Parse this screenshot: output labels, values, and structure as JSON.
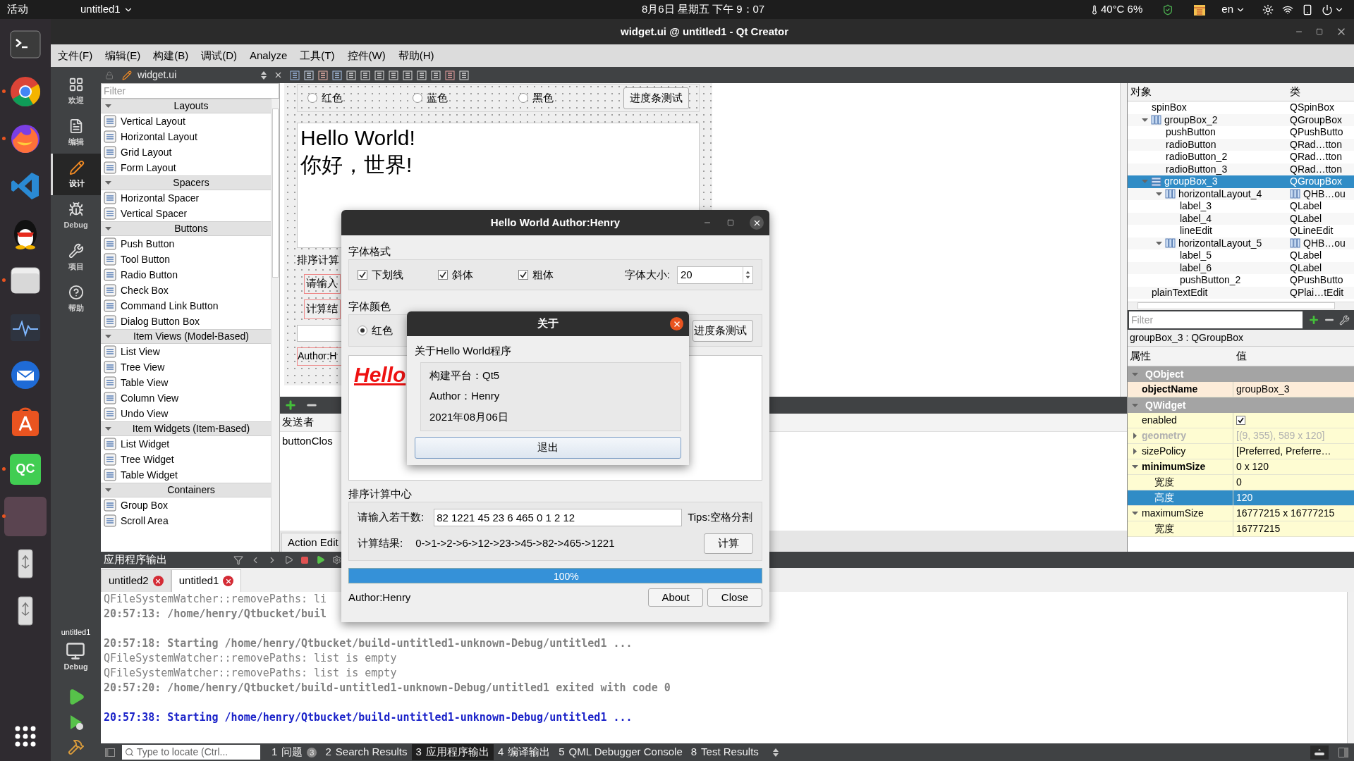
{
  "top_bar": {
    "activities": "活动",
    "app_menu": "untitled1",
    "clock": "8月6日 星期五 下午 9：07",
    "sensors": "40°C 6%",
    "input_method": "en"
  },
  "dock": [
    {
      "kind": "terminal",
      "running": false
    },
    {
      "kind": "chrome",
      "running": true
    },
    {
      "kind": "firefox",
      "running": true
    },
    {
      "kind": "code",
      "running": false
    },
    {
      "kind": "penguin",
      "running": false
    },
    {
      "kind": "files",
      "running": true
    },
    {
      "kind": "monitor",
      "running": false
    },
    {
      "kind": "mail",
      "running": false
    },
    {
      "kind": "store",
      "running": false
    },
    {
      "kind": "qc",
      "label": "QC",
      "running": true
    },
    {
      "kind": "window",
      "running": true
    },
    {
      "kind": "usb",
      "running": false
    },
    {
      "kind": "usb",
      "running": false
    },
    {
      "kind": "apps",
      "running": false
    }
  ],
  "window": {
    "title": "widget.ui @ untitled1 - Qt Creator"
  },
  "menu": [
    "文件(F)",
    "编辑(E)",
    "构建(B)",
    "调试(D)",
    "Analyze",
    "工具(T)",
    "控件(W)",
    "帮助(H)"
  ],
  "modes": [
    {
      "kind": "welcome",
      "label": "欢迎",
      "selected": false
    },
    {
      "kind": "edit",
      "label": "编辑",
      "selected": false
    },
    {
      "kind": "design",
      "label": "设计",
      "selected": true
    },
    {
      "kind": "debug",
      "label": "Debug",
      "selected": false
    },
    {
      "kind": "projects",
      "label": "项目",
      "selected": false
    },
    {
      "kind": "help",
      "label": "帮助",
      "selected": false
    }
  ],
  "run_target": {
    "project": "untitled1",
    "config": "Debug"
  },
  "editor_tab": {
    "file": "widget.ui"
  },
  "widget_box": {
    "filter_placeholder": "Filter",
    "sections": [
      {
        "title": "Layouts",
        "expanded": true,
        "items": [
          "Vertical Layout",
          "Horizontal Layout",
          "Grid Layout",
          "Form Layout"
        ]
      },
      {
        "title": "Spacers",
        "expanded": true,
        "items": [
          "Horizontal Spacer",
          "Vertical Spacer"
        ]
      },
      {
        "title": "Buttons",
        "expanded": true,
        "items": [
          "Push Button",
          "Tool Button",
          "Radio Button",
          "Check Box",
          "Command Link Button",
          "Dialog Button Box"
        ]
      },
      {
        "title": "Item Views (Model-Based)",
        "expanded": true,
        "items": [
          "List View",
          "Tree View",
          "Table View",
          "Column View",
          "Undo View"
        ]
      },
      {
        "title": "Item Widgets (Item-Based)",
        "expanded": true,
        "items": [
          "List Widget",
          "Tree Widget",
          "Table Widget"
        ]
      },
      {
        "title": "Containers",
        "expanded": true,
        "items": [
          "Group Box",
          "Scroll Area"
        ]
      }
    ]
  },
  "form_preview": {
    "radios": [
      {
        "label": "红色",
        "selected": false
      },
      {
        "label": "蓝色",
        "selected": false
      },
      {
        "label": "黑色",
        "selected": false
      }
    ],
    "button": "进度条测试",
    "text_lines": [
      "Hello World!",
      "你好，世界!"
    ],
    "group_title": "排序计算",
    "row_labels": [
      "请输入",
      "计算结"
    ],
    "author": "Author:H"
  },
  "signal_slot_editor": {
    "column": "发送者",
    "rows": [
      "buttonClos"
    ],
    "tab": "Action Edit"
  },
  "object_inspector": {
    "columns": [
      "对象",
      "类"
    ],
    "tree": [
      {
        "kind": "widget",
        "name": "spinBox",
        "class": "QSpinBox",
        "selected": false
      },
      {
        "kind": "hbox_group",
        "name": "groupBox_2",
        "class": "QGroupBox",
        "expanded": true,
        "selected": false,
        "children": [
          {
            "kind": "widget",
            "name": "pushButton",
            "class": "QPushButto",
            "selected": false
          },
          {
            "kind": "widget",
            "name": "radioButton",
            "class": "QRad…tton",
            "selected": false
          },
          {
            "kind": "widget",
            "name": "radioButton_2",
            "class": "QRad…tton",
            "selected": false
          },
          {
            "kind": "widget",
            "name": "radioButton_3",
            "class": "QRad…tton",
            "selected": false
          }
        ]
      },
      {
        "kind": "vbox_group",
        "name": "groupBox_3",
        "class": "QGroupBox",
        "expanded": true,
        "selected": true,
        "children": [
          {
            "kind": "hbox_layout",
            "name": "horizontalLayout_4",
            "class": "QHB…ou",
            "expanded": true,
            "selected": false,
            "children": [
              {
                "kind": "widget",
                "name": "label_3",
                "class": "QLabel",
                "selected": false
              },
              {
                "kind": "widget",
                "name": "label_4",
                "class": "QLabel",
                "selected": false
              },
              {
                "kind": "widget",
                "name": "lineEdit",
                "class": "QLineEdit",
                "selected": false
              }
            ]
          },
          {
            "kind": "hbox_layout",
            "name": "horizontalLayout_5",
            "class": "QHB…ou",
            "expanded": true,
            "selected": false,
            "children": [
              {
                "kind": "widget",
                "name": "label_5",
                "class": "QLabel",
                "selected": false
              },
              {
                "kind": "widget",
                "name": "label_6",
                "class": "QLabel",
                "selected": false
              },
              {
                "kind": "widget",
                "name": "pushButton_2",
                "class": "QPushButto",
                "selected": false
              }
            ]
          }
        ]
      },
      {
        "kind": "widget",
        "name": "plainTextEdit",
        "class": "QPlai…tEdit",
        "selected": false
      }
    ]
  },
  "property_editor": {
    "filter_placeholder": "Filter",
    "selection": "groupBox_3 : QGroupBox",
    "columns": [
      "属性",
      "值"
    ],
    "groups": [
      {
        "name": "QObject",
        "expanded": true,
        "properties": [
          {
            "kind": "text",
            "name": "objectName",
            "value": "groupBox_3",
            "modified": true,
            "disabled": false,
            "selected": false
          }
        ]
      },
      {
        "name": "QWidget",
        "expanded": true,
        "properties": [
          {
            "kind": "bool",
            "name": "enabled",
            "checked": true,
            "modified": false,
            "disabled": false,
            "selected": false
          },
          {
            "kind": "text",
            "name": "geometry",
            "value": "[(9, 355), 589 x 120]",
            "modified": true,
            "disabled": true,
            "selected": false,
            "expanded": false
          },
          {
            "kind": "text",
            "name": "sizePolicy",
            "value": "[Preferred, Preferre…",
            "modified": false,
            "disabled": false,
            "selected": false,
            "expanded": false
          },
          {
            "kind": "text",
            "name": "minimumSize",
            "value": "0 x 120",
            "modified": true,
            "disabled": false,
            "selected": false,
            "expanded": true,
            "children": [
              {
                "kind": "text",
                "name": "宽度",
                "value": "0",
                "modified": false,
                "disabled": false,
                "selected": false
              },
              {
                "kind": "text",
                "name": "高度",
                "value": "120",
                "modified": false,
                "disabled": false,
                "selected": true
              }
            ]
          },
          {
            "kind": "text",
            "name": "maximumSize",
            "value": "16777215 x 16777215",
            "modified": false,
            "disabled": false,
            "selected": false,
            "expanded": true,
            "children": [
              {
                "kind": "text",
                "name": "宽度",
                "value": "16777215",
                "modified": false,
                "disabled": false,
                "selected": false
              }
            ]
          }
        ]
      }
    ]
  },
  "output": {
    "title": "应用程序输出",
    "tabs": [
      {
        "label": "untitled2",
        "selected": false
      },
      {
        "label": "untitled1",
        "selected": true
      }
    ],
    "lines": [
      {
        "kind": "message",
        "text": "QFileSystemWatcher::removePaths: li",
        "gap_before": false
      },
      {
        "kind": "status",
        "text": "20:57:13: /home/henry/Qtbucket/buil",
        "gap_before": false
      },
      {
        "kind": "status",
        "text": "20:57:18: Starting /home/henry/Qtbucket/build-untitled1-unknown-Debug/untitled1 ...",
        "gap_before": true
      },
      {
        "kind": "message",
        "text": "QFileSystemWatcher::removePaths: list is empty",
        "gap_before": false
      },
      {
        "kind": "message",
        "text": "QFileSystemWatcher::removePaths: list is empty",
        "gap_before": false
      },
      {
        "kind": "status",
        "text": "20:57:20: /home/henry/Qtbucket/build-untitled1-unknown-Debug/untitled1 exited with code 0",
        "gap_before": false
      },
      {
        "kind": "start",
        "text": "20:57:38: Starting /home/henry/Qtbucket/build-untitled1-unknown-Debug/untitled1 ...",
        "gap_before": true
      }
    ]
  },
  "status_bar": {
    "locator_placeholder": "Type to locate (Ctrl...",
    "panes": [
      {
        "number": "1",
        "label": "问题",
        "badge": "3",
        "selected": false
      },
      {
        "number": "2",
        "label": "Search Results",
        "selected": false
      },
      {
        "number": "3",
        "label": "应用程序输出",
        "selected": true
      },
      {
        "number": "4",
        "label": "编译输出",
        "selected": false
      },
      {
        "number": "5",
        "label": "QML Debugger Console",
        "selected": false
      },
      {
        "number": "8",
        "label": "Test Results",
        "selected": false
      }
    ]
  },
  "app_dialog": {
    "title": "Hello World Author:Henry",
    "format_group": "字体格式",
    "styles": [
      {
        "label": "下划线",
        "checked": true
      },
      {
        "label": "斜体",
        "checked": true
      },
      {
        "label": "粗体",
        "checked": true
      }
    ],
    "size_label": "字体大小:",
    "size_value": "20",
    "color_group": "字体颜色",
    "colors": [
      {
        "label": "红色",
        "selected": true
      }
    ],
    "progress_button": "进度条测试",
    "preview_text": "Hello",
    "sort_group": "排序计算中心",
    "input_label": "请输入若干数:",
    "input_value": "82 1221 45 23 6 465 0 1 2 12",
    "tips": "Tips:空格分割",
    "result_label": "计算结果:",
    "result_value": "0->1->2->6->12->23->45->82->465->1221",
    "compute_button": "计算",
    "progress": {
      "level": 1,
      "text": "100%"
    },
    "author": "Author:Henry",
    "buttons": [
      "About",
      "Close"
    ]
  },
  "about_dialog": {
    "title": "关于",
    "heading": "关于Hello World程序",
    "lines": [
      "构建平台：Qt5",
      "Author：Henry",
      "2021年08月06日"
    ],
    "button": "退出"
  }
}
